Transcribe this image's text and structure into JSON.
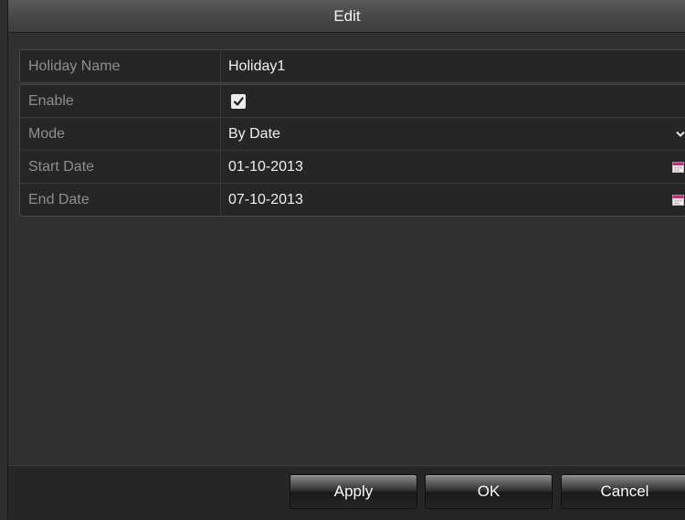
{
  "dialog": {
    "title": "Edit"
  },
  "holiday": {
    "name_label": "Holiday Name",
    "name_value": "Holiday1"
  },
  "fields": {
    "enable_label": "Enable",
    "enable_checked": true,
    "mode_label": "Mode",
    "mode_value": "By Date",
    "start_label": "Start Date",
    "start_value": "01-10-2013",
    "end_label": "End Date",
    "end_value": "07-10-2013"
  },
  "buttons": {
    "apply": "Apply",
    "ok": "OK",
    "cancel": "Cancel"
  },
  "icons": {
    "checkbox": "check-icon",
    "mode_dropdown": "chevron-down-icon",
    "start_calendar": "calendar-icon",
    "end_calendar": "calendar-icon"
  },
  "colors": {
    "background": "#303030",
    "calendar_accent": "#c0307a"
  }
}
